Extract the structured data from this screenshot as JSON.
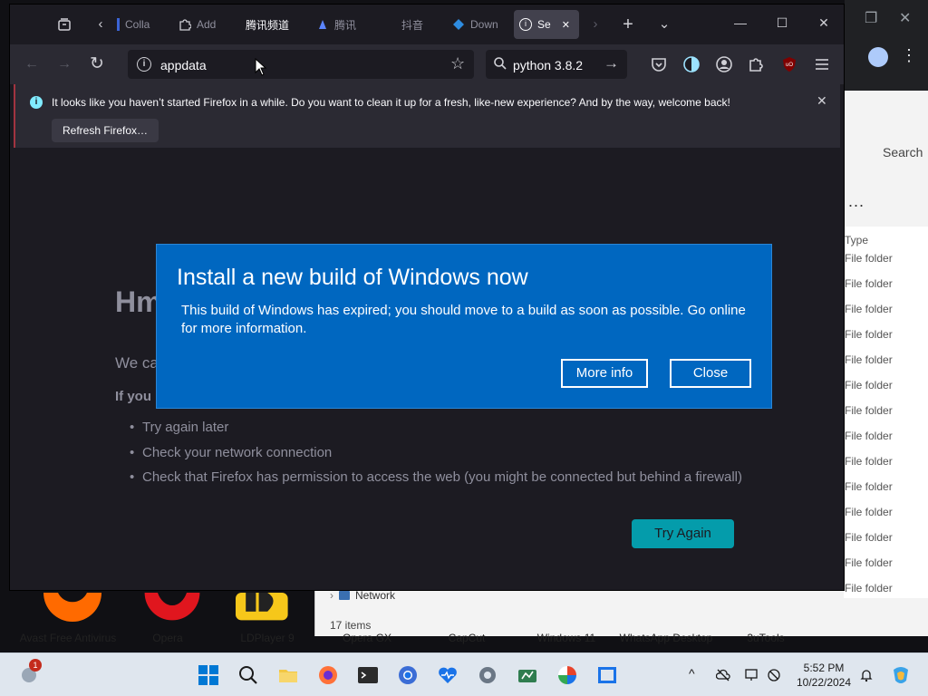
{
  "firefox": {
    "tabs": [
      {
        "label": "",
        "icon": "tab-overview-icon"
      },
      {
        "label": "Colla",
        "icon": "collab-icon"
      },
      {
        "label": "Add",
        "icon": "puzzle-icon"
      },
      {
        "label": "腾讯频道",
        "icon": "channel-icon"
      },
      {
        "label": "腾讯",
        "icon": "tencent-icon"
      },
      {
        "label": "抖音",
        "icon": "douyin-icon"
      },
      {
        "label": "Down",
        "icon": "download-icon"
      },
      {
        "label": "Se",
        "icon": "info-icon",
        "close": "✕"
      }
    ],
    "nav": {
      "back": "←",
      "forward": "→",
      "reload": "↻",
      "url": "appdata",
      "search_query": "python 3.8.2"
    },
    "notification": {
      "message": "It looks like you haven’t started Firefox in a while. Do you want to clean it up for a fresh, like-new experience? And by the way, welcome back!",
      "button": "Refresh Firefox…",
      "close": "✕"
    },
    "error_page": {
      "heading": "Hm",
      "intro": "We ca",
      "if_you": "If you",
      "bullets": [
        "Try again later",
        "Check your network connection",
        "Check that Firefox has permission to access the web (you might be connected but behind a firewall)"
      ],
      "try_again": "Try Again"
    }
  },
  "dialog": {
    "title": "Install a new build of Windows now",
    "body": "This build of Windows has expired; you should move to a build as soon as possible. Go online for more information.",
    "more_info": "More info",
    "close": "Close"
  },
  "explorer": {
    "search": "Search",
    "more": "...",
    "type_header": "Type",
    "type_values": [
      "File folder",
      "File folder",
      "File folder",
      "File folder",
      "File folder",
      "File folder",
      "File folder",
      "File folder",
      "File folder",
      "File folder",
      "File folder",
      "File folder",
      "File folder",
      "File folder"
    ],
    "nav_network": "Network",
    "status": "17 items"
  },
  "desktop_icons": [
    {
      "label": "Avast Free Antivirus",
      "color": "#ff6a00"
    },
    {
      "label": "Opera",
      "color": "#e0161e"
    },
    {
      "label": "LDPlayer 9",
      "color": "#f6c71a"
    },
    {
      "label": "Opera GX",
      "color": ""
    },
    {
      "label": "CapCut",
      "color": ""
    },
    {
      "label": "Windows 11",
      "color": ""
    },
    {
      "label": "WhatsApp Desktop",
      "color": ""
    },
    {
      "label": "3uTools",
      "color": ""
    }
  ],
  "taskbar": {
    "time": "5:52 PM",
    "date": "10/22/2024",
    "notification_count": "1",
    "tray_chevron": "^",
    "icons": [
      "start-icon",
      "search-icon",
      "file-explorer-icon",
      "firefox-icon",
      "terminal-icon",
      "chrome-icon",
      "health-icon",
      "settings-icon",
      "app-icon",
      "vpn-icon",
      "vm-icon"
    ]
  }
}
